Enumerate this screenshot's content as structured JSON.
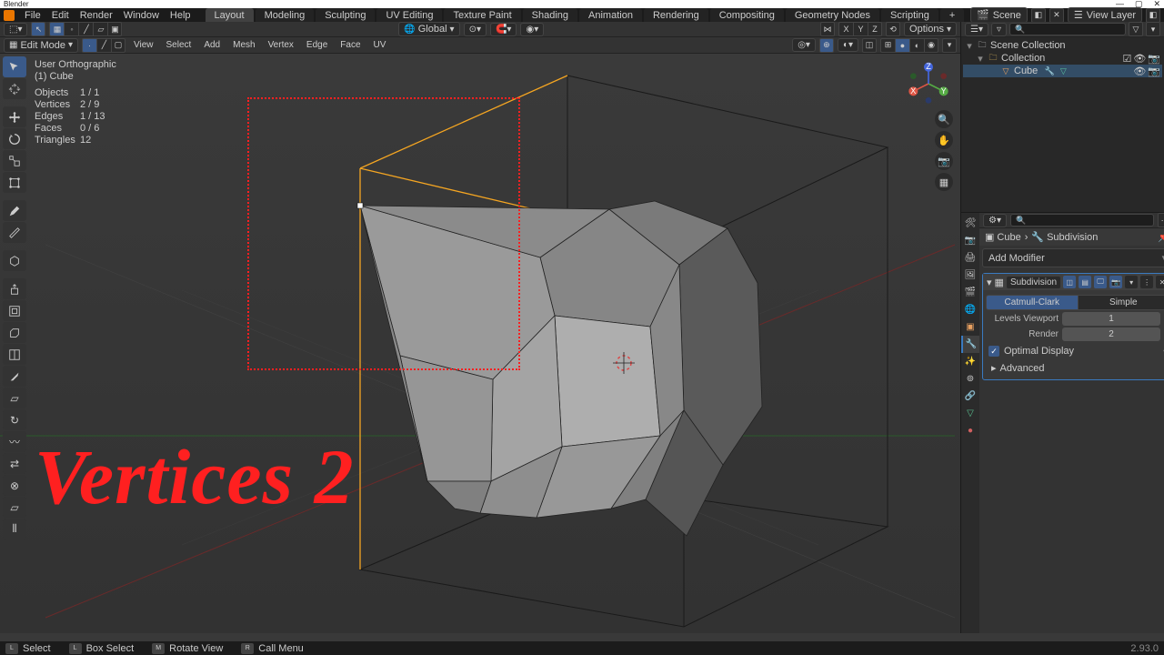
{
  "app": {
    "title": "Blender",
    "version": "2.93.0"
  },
  "menu": {
    "file": "File",
    "edit": "Edit",
    "render": "Render",
    "window": "Window",
    "help": "Help"
  },
  "workspaces": [
    "Layout",
    "Modeling",
    "Sculpting",
    "UV Editing",
    "Texture Paint",
    "Shading",
    "Animation",
    "Rendering",
    "Compositing",
    "Geometry Nodes",
    "Scripting"
  ],
  "scene_field": {
    "label": "Scene",
    "value": "Scene"
  },
  "viewlayer_field": {
    "label": "View Layer",
    "value": "View Layer"
  },
  "v3d_header": {
    "orientation": "Global",
    "options": "Options"
  },
  "v3d_header2": {
    "mode": "Edit Mode",
    "menus": [
      "View",
      "Select",
      "Add",
      "Mesh",
      "Vertex",
      "Edge",
      "Face",
      "UV"
    ]
  },
  "stats": {
    "view": "User Orthographic",
    "obj": "(1) Cube",
    "rows": [
      {
        "l": "Objects",
        "v": "1 / 1"
      },
      {
        "l": "Vertices",
        "v": "2 / 9"
      },
      {
        "l": "Edges",
        "v": "1 / 13"
      },
      {
        "l": "Faces",
        "v": "0 / 6"
      },
      {
        "l": "Triangles",
        "v": "12"
      }
    ]
  },
  "overlay_text": "Vertices 2",
  "outliner": {
    "root": "Scene Collection",
    "collection": "Collection",
    "items": [
      {
        "name": "Cube"
      }
    ]
  },
  "props": {
    "breadcrumb": {
      "obj": "Cube",
      "mod": "Subdivision"
    },
    "add_modifier": "Add Modifier",
    "modifier": {
      "name": "Subdivision",
      "type_a": "Catmull-Clark",
      "type_b": "Simple",
      "levels_label": "Levels Viewport",
      "levels_value": "1",
      "render_label": "Render",
      "render_value": "2",
      "optimal": "Optimal Display",
      "advanced": "Advanced"
    }
  },
  "statusbar": {
    "select": "Select",
    "box": "Box Select",
    "rotate": "Rotate View",
    "menu": "Call Menu"
  }
}
